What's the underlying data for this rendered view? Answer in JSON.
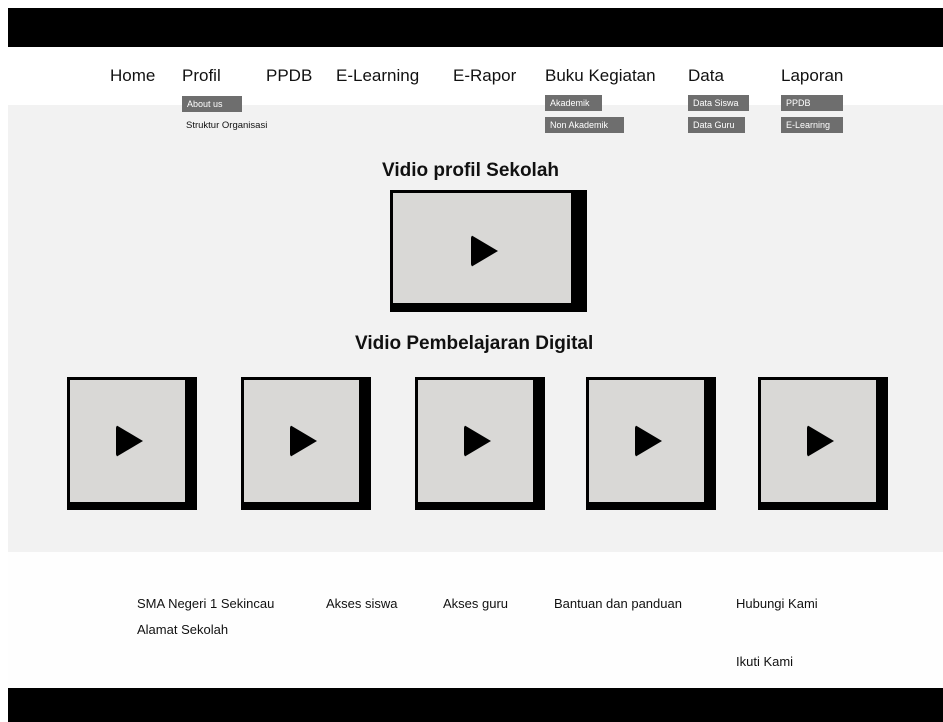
{
  "nav": {
    "home": "Home",
    "profil": "Profil",
    "ppdb": "PPDB",
    "elearning": "E-Learning",
    "erapor": "E-Rapor",
    "buku": "Buku Kegiatan",
    "data": "Data",
    "laporan": "Laporan"
  },
  "submenus": {
    "profil": [
      "About us",
      "Struktur Organisasi"
    ],
    "buku": [
      "Akademik",
      "Non Akademik"
    ],
    "data": [
      "Data Siswa",
      "Data Guru"
    ],
    "laporan": [
      "PPDB",
      "E-Learning"
    ]
  },
  "main": {
    "profile_title": "Vidio profil Sekolah",
    "digital_title": "Vidio Pembelajaran Digital",
    "digital_video_count": 5
  },
  "footer": {
    "school": "SMA Negeri 1 Sekincau",
    "address": "Alamat Sekolah",
    "akses_siswa": "Akses siswa",
    "akses_guru": "Akses guru",
    "bantuan": "Bantuan dan panduan",
    "hubungi": "Hubungi Kami",
    "ikuti": "Ikuti Kami"
  },
  "colors": {
    "bar": "#000000",
    "content_bg": "#f2f2f2",
    "video_fill": "#d9d8d6",
    "submenu_bg": "#6e6e6e"
  },
  "icons": {
    "play": "play-icon"
  }
}
